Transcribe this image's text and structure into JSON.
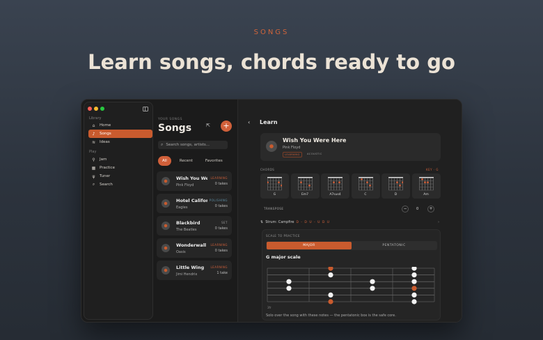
{
  "hero": {
    "eyebrow": "SONGS",
    "headline": "Learn songs, chords ready to go"
  },
  "colors": {
    "accent": "#d0603a",
    "traffic_red": "#ff5f57",
    "traffic_yellow": "#febc2e",
    "traffic_green": "#28c840"
  },
  "sidebar": {
    "library_label": "Library",
    "play_label": "Play",
    "items": [
      {
        "label": "Home",
        "icon": "home-icon"
      },
      {
        "label": "Songs",
        "icon": "music-note-icon",
        "active": true
      },
      {
        "label": "Ideas",
        "icon": "waveform-icon"
      },
      {
        "label": "Jam",
        "icon": "guitar-icon"
      },
      {
        "label": "Practice",
        "icon": "grid-icon"
      },
      {
        "label": "Tuner",
        "icon": "tuning-fork-icon"
      },
      {
        "label": "Search",
        "icon": "search-icon"
      }
    ]
  },
  "songs": {
    "eyebrow": "YOUR SONGS",
    "title": "Songs",
    "add_label": "+",
    "search_placeholder": "Search songs, artists...",
    "tabs": [
      "All",
      "Recent",
      "Favorites"
    ],
    "list": [
      {
        "title": "Wish You Were Here",
        "artist": "Pink Floyd",
        "status": "LEARNING",
        "status_color": "#d0603a",
        "takes": "0 takes"
      },
      {
        "title": "Hotel California",
        "artist": "Eagles",
        "status": "POLISHING",
        "status_color": "#5e8fa6",
        "takes": "0 takes"
      },
      {
        "title": "Blackbird",
        "artist": "The Beatles",
        "status": "SET",
        "status_color": "#9a9a9a",
        "takes": "0 takes"
      },
      {
        "title": "Wonderwall",
        "artist": "Oasis",
        "status": "LEARNING",
        "status_color": "#d0603a",
        "takes": "0 takes"
      },
      {
        "title": "Little Wing",
        "artist": "Jimi Hendrix",
        "status": "LEARNING",
        "status_color": "#d0603a",
        "takes": "1 take"
      }
    ]
  },
  "learn": {
    "title": "Learn",
    "song": {
      "title": "Wish You Were Here",
      "artist": "Pink Floyd",
      "tags": [
        "LEARNING",
        "ACOUSTIC"
      ]
    },
    "chords_label": "CHORDS",
    "key_label": "KEY · G",
    "chords": [
      "G",
      "Em7",
      "A7sus4",
      "C",
      "D",
      "Am"
    ],
    "transpose_label": "TRANSPOSE",
    "transpose_minus": "−",
    "transpose_value": "0",
    "transpose_plus": "+",
    "strum_label": "Strum: Campfire",
    "strum_pattern": "D - D U - U D U",
    "strum_chevron": "›",
    "scale": {
      "label": "SCALE TO PRACTICE",
      "options": [
        "MAJOR",
        "PENTATONIC"
      ],
      "selected": "MAJOR",
      "name": "G major scale",
      "fret_label": "3fr",
      "note": "Solo over the song with these notes — the pentatonic box is the safe core."
    }
  }
}
